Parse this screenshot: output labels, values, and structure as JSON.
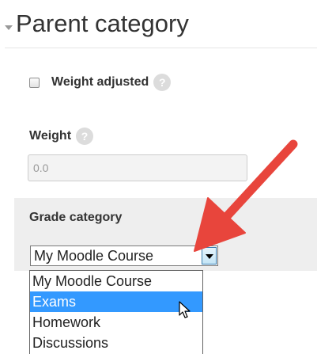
{
  "section": {
    "title": "Parent category"
  },
  "weight_adjusted": {
    "label": "Weight adjusted",
    "checked": false
  },
  "weight": {
    "label": "Weight",
    "value": "0.0"
  },
  "grade_category": {
    "label": "Grade category",
    "selected": "My Moodle Course",
    "options": [
      "My Moodle Course",
      "Exams",
      "Homework",
      "Discussions"
    ],
    "highlighted_option": "Exams"
  },
  "icons": {
    "help": "?",
    "collapse": "chevron-down-icon",
    "dropdown": "caret-down-icon",
    "cursor": "mouse-pointer-icon"
  },
  "colors": {
    "annotation_arrow": "#e8453c",
    "highlight": "#3399ff",
    "panel": "#eeeeee"
  }
}
